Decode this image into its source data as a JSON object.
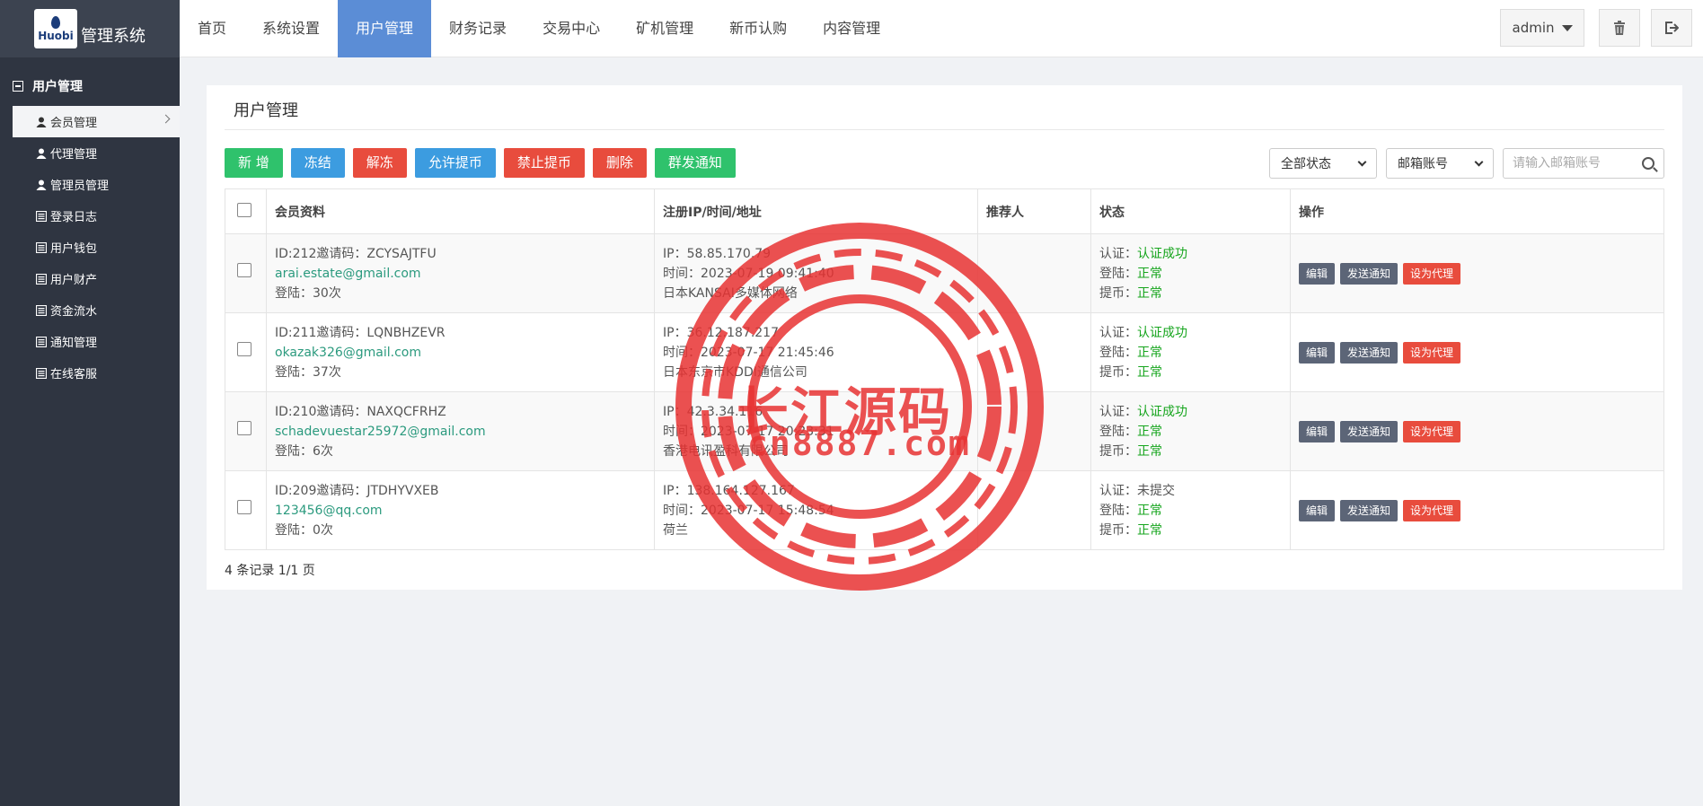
{
  "brand": {
    "logo_text": "Huobi",
    "title": "管理系统"
  },
  "sidebar": {
    "group": "用户管理",
    "items": [
      {
        "label": "会员管理",
        "icon": "user-icon",
        "active": true
      },
      {
        "label": "代理管理",
        "icon": "user-icon"
      },
      {
        "label": "管理员管理",
        "icon": "user-icon"
      },
      {
        "label": "登录日志",
        "icon": "list-icon"
      },
      {
        "label": "用户钱包",
        "icon": "list-icon"
      },
      {
        "label": "用户财产",
        "icon": "list-icon"
      },
      {
        "label": "资金流水",
        "icon": "list-icon"
      },
      {
        "label": "通知管理",
        "icon": "list-icon"
      },
      {
        "label": "在线客服",
        "icon": "list-icon"
      }
    ]
  },
  "nav": {
    "items": [
      "首页",
      "系统设置",
      "用户管理",
      "财务记录",
      "交易中心",
      "矿机管理",
      "新币认购",
      "内容管理"
    ],
    "active_index": 2
  },
  "user": {
    "name": "admin"
  },
  "panel": {
    "title": "用户管理"
  },
  "toolbar": {
    "add": "新 增",
    "freeze": "冻结",
    "unfreeze": "解冻",
    "allow_withdraw": "允许提币",
    "ban_withdraw": "禁止提币",
    "delete": "删除",
    "notify": "群发通知"
  },
  "filters": {
    "status": "全部状态",
    "field": "邮箱账号",
    "search_placeholder": "请输入邮箱账号"
  },
  "table": {
    "headers": {
      "member": "会员资料",
      "register": "注册IP/时间/地址",
      "referrer": "推荐人",
      "status": "状态",
      "actions": "操作"
    },
    "rows": [
      {
        "id": "ID:212邀请码：ZCYSAJTFU",
        "email": "arai.estate@gmail.com",
        "logins": "登陆：30次",
        "ip": "IP：58.85.170.79",
        "time": "时间：2023-07-19 09:41:40",
        "addr": "日本KANSAI多媒体网络",
        "referrer": "",
        "auth_label": "认证：",
        "auth": "认证成功",
        "login_label": "登陆：",
        "login": "正常",
        "withdraw_label": "提币：",
        "withdraw": "正常"
      },
      {
        "id": "ID:211邀请码：LQNBHZEVR",
        "email": "okazak326@gmail.com",
        "logins": "登陆：37次",
        "ip": "IP：36.12.187.217",
        "time": "时间：2023-07-17 21:45:46",
        "addr": "日本东京市KDDI通信公司",
        "referrer": "",
        "auth_label": "认证：",
        "auth": "认证成功",
        "login_label": "登陆：",
        "login": "正常",
        "withdraw_label": "提币：",
        "withdraw": "正常"
      },
      {
        "id": "ID:210邀请码：NAXQCFRHZ",
        "email": "schadevuestar25972@gmail.com",
        "logins": "登陆：6次",
        "ip": "IP：42.3.34.116",
        "time": "时间：2023-07-17 20:23:31",
        "addr": "香港电讯盈科有限公司",
        "referrer": "",
        "auth_label": "认证：",
        "auth": "认证成功",
        "login_label": "登陆：",
        "login": "正常",
        "withdraw_label": "提币：",
        "withdraw": "正常"
      },
      {
        "id": "ID:209邀请码：JTDHYVXEB",
        "email": "123456@qq.com",
        "logins": "登陆：0次",
        "ip": "IP：138.164.127.167",
        "time": "时间：2023-07-17 15:48:54",
        "addr": "荷兰",
        "referrer": "",
        "auth_label": "认证：",
        "auth": "未提交",
        "login_label": "登陆：",
        "login": "正常",
        "withdraw_label": "提币：",
        "withdraw": "正常"
      }
    ],
    "row_actions": {
      "edit": "编辑",
      "notify": "发送通知",
      "agent": "设为代理"
    }
  },
  "pager": {
    "summary": "4 条记录 1/1 页"
  },
  "watermark": {
    "line1": "长江源码",
    "line2": "cn8887.com"
  },
  "colors": {
    "sidebar": "#2f3541",
    "nav_active": "#5b8dd6",
    "green": "#2fc26c",
    "blue": "#3c9ce0",
    "red": "#e84c3d",
    "ok": "#16a51d",
    "stamp": "#e83232"
  }
}
